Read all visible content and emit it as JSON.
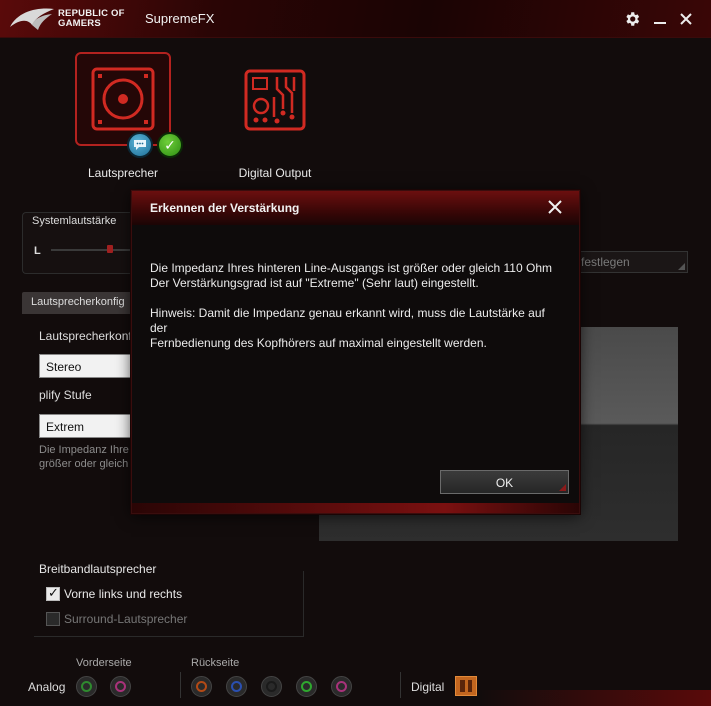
{
  "app": {
    "brand_line1": "REPUBLIC OF",
    "brand_line2": "GAMERS",
    "title": "SupremeFX"
  },
  "window_controls": {
    "settings_icon": "gear-icon",
    "minimize_icon": "minimize-icon",
    "close_icon": "close-icon"
  },
  "devices": [
    {
      "label": "Lautsprecher",
      "selected": true
    },
    {
      "label": "Digital Output",
      "selected": false
    }
  ],
  "volume": {
    "label": "Systemlautstärke",
    "left_channel": "L"
  },
  "tabs": {
    "speaker_config": "Lautsprecherkonfig"
  },
  "config": {
    "konf_label": "Lautsprecherkonf",
    "konf_value": "Stereo",
    "stufe_label": "plify Stufe",
    "stufe_value": "Extrem",
    "hint_line1": "Die Impedanz Ihre",
    "hint_line2": "größer oder gleich"
  },
  "festlegen_button": "festlegen",
  "breitband": {
    "heading": "Breitbandlautsprecher",
    "front": {
      "label": "Vorne links und rechts",
      "checked": true
    },
    "surround": {
      "label": "Surround-Lautsprecher",
      "checked": false
    }
  },
  "jacks": {
    "front_heading": "Vorderseite",
    "rear_heading": "Rückseite",
    "analog_label": "Analog",
    "digital_label": "Digital",
    "front_colors": [
      "#2f8a2f",
      "#a8327a"
    ],
    "rear_colors": [
      "#b34a16",
      "#2a4fb0",
      "#1a1a1a",
      "#2fa82f",
      "#a8327a"
    ]
  },
  "dialog": {
    "title": "Erkennen der Verstärkung",
    "line1": "Die Impedanz Ihres hinteren Line-Ausgangs ist größer oder gleich 110 Ohm",
    "line2": "Der Verstärkungsgrad ist auf \"Extreme\" (Sehr laut) eingestellt.",
    "line3": "Hinweis: Damit die Impedanz genau erkannt wird, muss die Lautstärke auf der",
    "line4": "Fernbedienung des Kopfhörers auf maximal eingestellt werden.",
    "ok_label": "OK"
  }
}
